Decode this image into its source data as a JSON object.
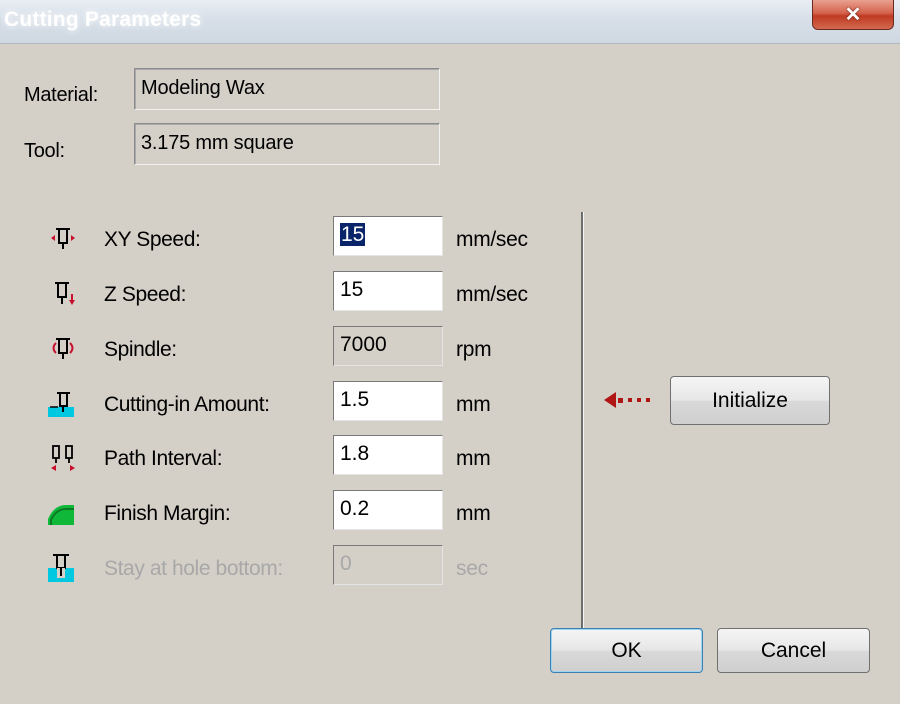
{
  "window": {
    "title": "Cutting Parameters",
    "close_glyph": "✕"
  },
  "info": {
    "material_label": "Material:",
    "material_value": "Modeling Wax",
    "tool_label": "Tool:",
    "tool_value": "3.175 mm square"
  },
  "params": [
    {
      "icon": "xy-speed-icon",
      "label": "XY Speed:",
      "value": "15",
      "unit": "mm/sec",
      "state": "focused-selected"
    },
    {
      "icon": "z-speed-icon",
      "label": "Z Speed:",
      "value": "15",
      "unit": "mm/sec",
      "state": "editable"
    },
    {
      "icon": "spindle-icon",
      "label": "Spindle:",
      "value": "7000",
      "unit": "rpm",
      "state": "readonly"
    },
    {
      "icon": "cutting-in-icon",
      "label": "Cutting-in Amount:",
      "value": "1.5",
      "unit": "mm",
      "state": "editable"
    },
    {
      "icon": "path-interval-icon",
      "label": "Path Interval:",
      "value": "1.8",
      "unit": "mm",
      "state": "editable"
    },
    {
      "icon": "finish-margin-icon",
      "label": "Finish Margin:",
      "value": "0.2",
      "unit": "mm",
      "state": "editable"
    },
    {
      "icon": "hole-bottom-icon",
      "label": "Stay at hole bottom:",
      "value": "0",
      "unit": "sec",
      "state": "disabled"
    }
  ],
  "buttons": {
    "initialize": "Initialize",
    "ok": "OK",
    "cancel": "Cancel"
  },
  "colors": {
    "dialog_bg": "#d4d0c8",
    "arrow_red": "#b01616",
    "icon_cyan": "#00c8e0",
    "icon_green": "#10b83a",
    "selection_bg": "#0a246a"
  }
}
